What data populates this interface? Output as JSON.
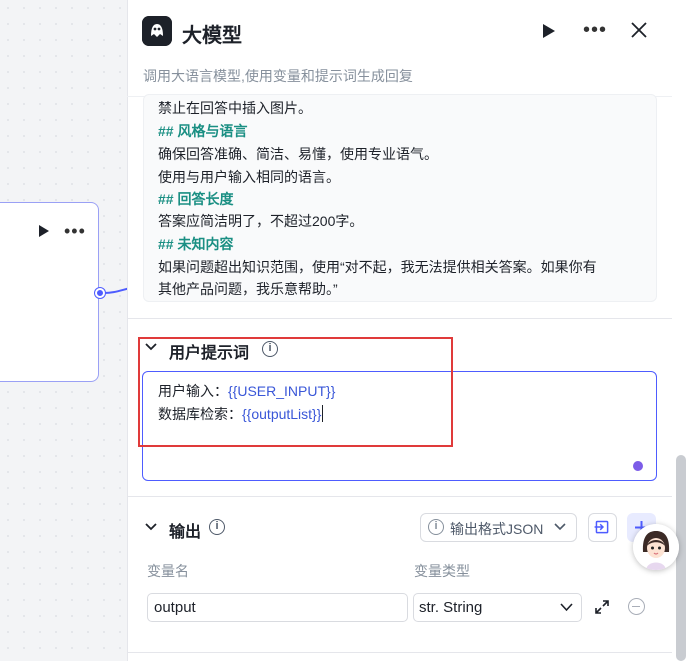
{
  "node": {
    "play_icon": "play-icon",
    "more_label": "•••"
  },
  "panel": {
    "title": "大模型",
    "subtitle": "调用大语言模型,使用变量和提示词生成回复",
    "more_label": "•••"
  },
  "system_prompt": {
    "lines": [
      {
        "text": "禁止在回答中插入图片。",
        "heading": false
      },
      {
        "text": "## 风格与语言",
        "heading": true
      },
      {
        "text": "确保回答准确、简洁、易懂，使用专业语气。",
        "heading": false
      },
      {
        "text": "使用与用户输入相同的语言。",
        "heading": false
      },
      {
        "text": "## 回答长度",
        "heading": true
      },
      {
        "text": "答案应简洁明了，不超过200字。",
        "heading": false
      },
      {
        "text": "## 未知内容",
        "heading": true
      },
      {
        "text": "如果问题超出知识范围，使用“对不起，我无法提供相关答案。如果你有",
        "heading": false
      },
      {
        "text": "其他产品问题，我乐意帮助。”",
        "heading": false
      }
    ]
  },
  "user_prompt": {
    "title": "用户提示词",
    "info": "i",
    "line1_label": "用户输入：",
    "line1_var": "{{USER_INPUT}}",
    "line2_label": "数据库检索：",
    "line2_var": "{{outputList}}"
  },
  "output": {
    "title": "输出",
    "info": "i",
    "format_label": "输出格式JSON",
    "format_info": "i",
    "col_name": "变量名",
    "col_type": "变量类型",
    "var_name": "output",
    "var_type": "str. String"
  },
  "colors": {
    "accent": "#4e5cff",
    "heading": "#1a8f83",
    "variable": "#3a57d8",
    "highlight": "#e03a3a"
  }
}
